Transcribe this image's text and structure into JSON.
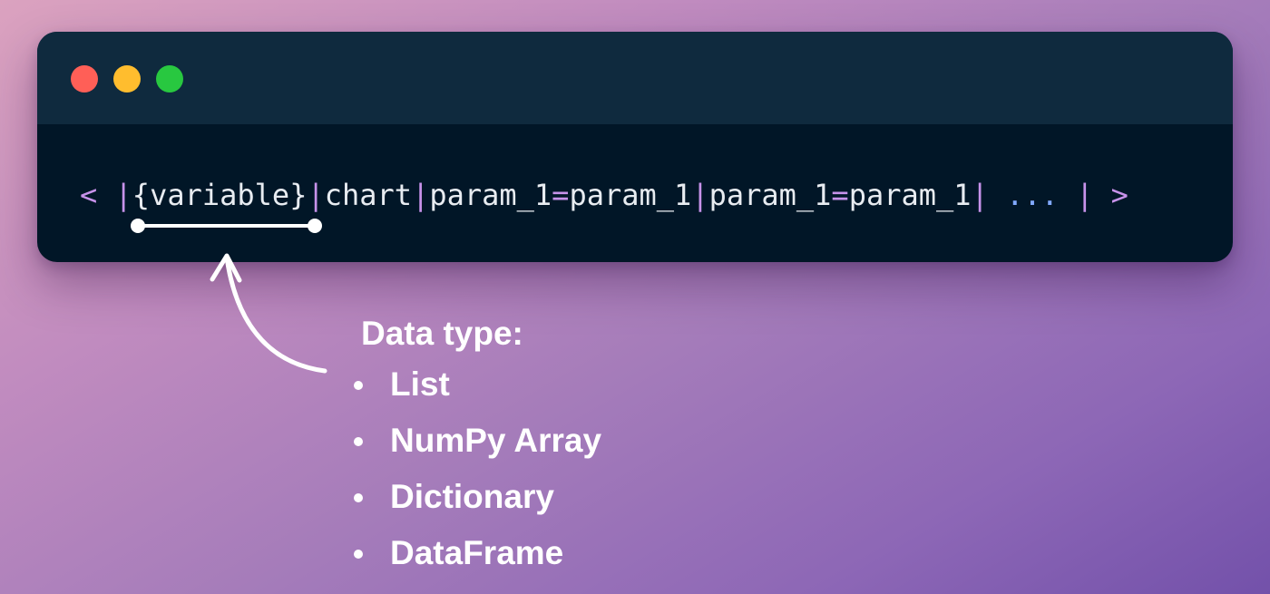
{
  "window": {
    "controls": [
      {
        "name": "close",
        "color": "#ff5f57"
      },
      {
        "name": "minimize",
        "color": "#ffbd2e"
      },
      {
        "name": "zoom",
        "color": "#28c840"
      }
    ]
  },
  "code": {
    "tokens": [
      {
        "text": "< |",
        "color": "#c792ea"
      },
      {
        "text": "{variable}",
        "color": "#e8ecf1"
      },
      {
        "text": "|",
        "color": "#c792ea"
      },
      {
        "text": "chart",
        "color": "#e8ecf1"
      },
      {
        "text": "|",
        "color": "#c792ea"
      },
      {
        "text": "param_1",
        "color": "#e8ecf1"
      },
      {
        "text": "=",
        "color": "#c792ea"
      },
      {
        "text": "param_1",
        "color": "#e8ecf1"
      },
      {
        "text": "|",
        "color": "#c792ea"
      },
      {
        "text": "param_1",
        "color": "#e8ecf1"
      },
      {
        "text": "=",
        "color": "#c792ea"
      },
      {
        "text": "param_1",
        "color": "#e8ecf1"
      },
      {
        "text": "| ",
        "color": "#c792ea"
      },
      {
        "text": "...",
        "color": "#82aaff"
      },
      {
        "text": " | >",
        "color": "#c792ea"
      }
    ]
  },
  "annotation": {
    "title": "Data type:",
    "items": [
      "List",
      "NumPy Array",
      "Dictionary",
      "DataFrame"
    ],
    "color": "#ffffff"
  }
}
